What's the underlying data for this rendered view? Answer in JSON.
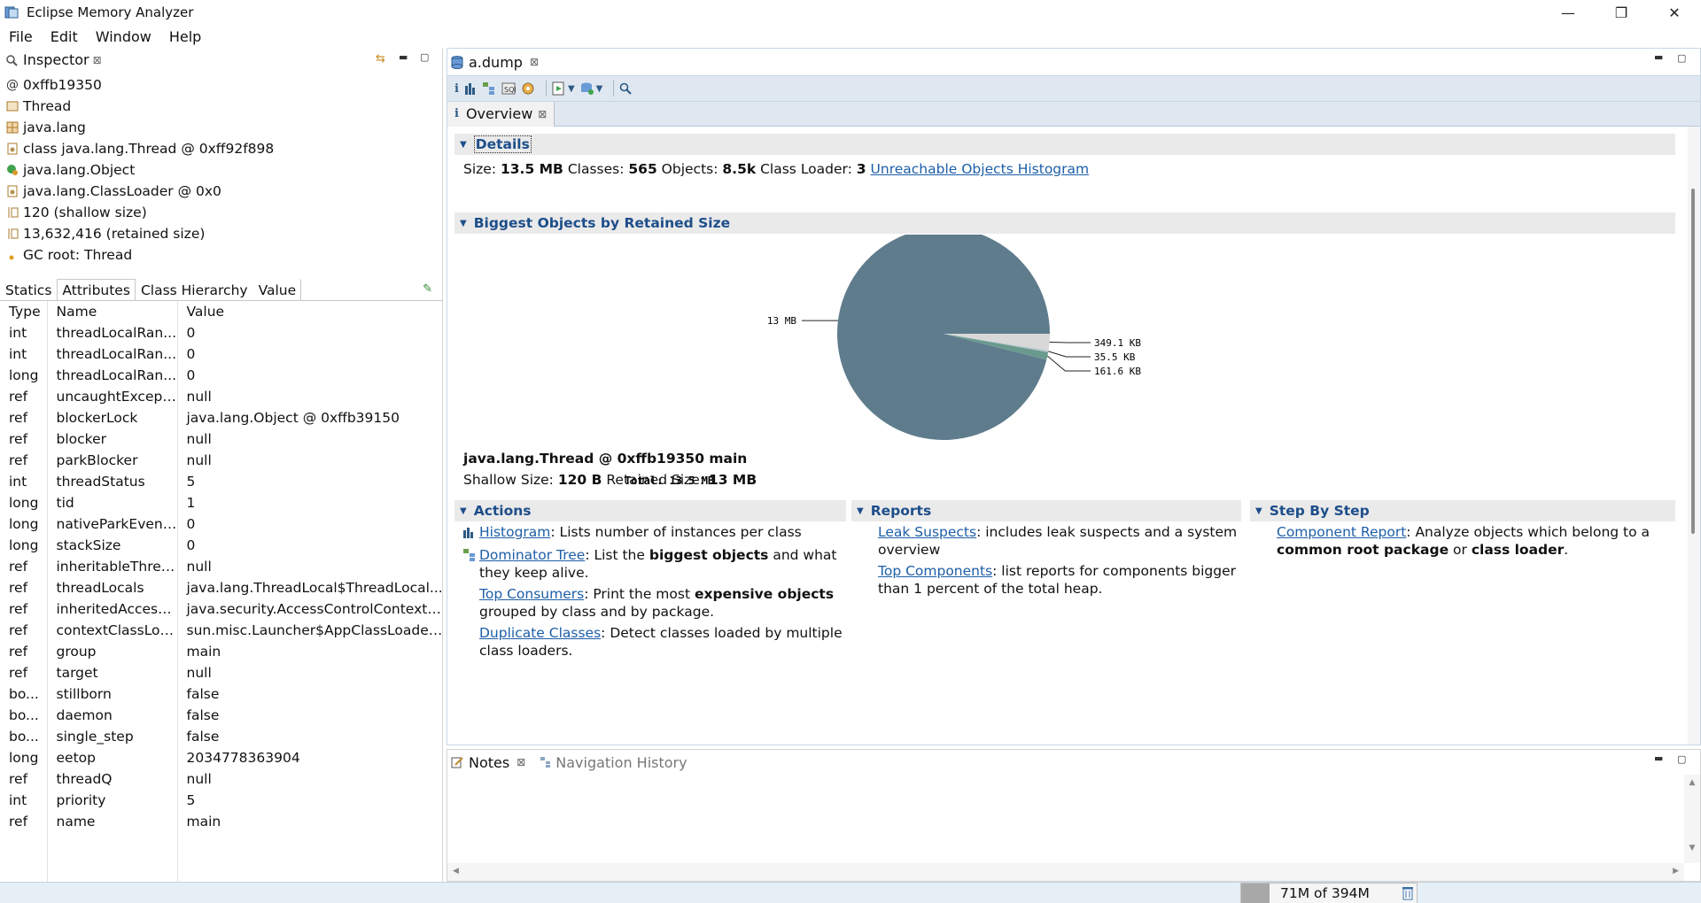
{
  "window": {
    "title": "Eclipse Memory Analyzer",
    "min": "—",
    "max": "❐",
    "close": "✕"
  },
  "menu": [
    "File",
    "Edit",
    "Window",
    "Help"
  ],
  "inspector": {
    "tab": "Inspector",
    "summary": [
      {
        "icon": "at-icon",
        "text": "0xffb19350"
      },
      {
        "icon": "class-icon",
        "text": "Thread"
      },
      {
        "icon": "package-icon",
        "text": "java.lang"
      },
      {
        "icon": "class-file-icon",
        "text": "class java.lang.Thread @ 0xff92f898"
      },
      {
        "icon": "superclass-icon",
        "text": "java.lang.Object"
      },
      {
        "icon": "classloader-icon",
        "text": "java.lang.ClassLoader @ 0x0"
      },
      {
        "icon": "size-icon",
        "text": "120 (shallow size)"
      },
      {
        "icon": "size-icon",
        "text": "13,632,416 (retained size)"
      },
      {
        "icon": "gc-root-icon",
        "text": "GC root: Thread"
      }
    ],
    "subtabs": [
      "Statics",
      "Attributes",
      "Class Hierarchy",
      "Value"
    ],
    "columns": [
      "Type",
      "Name",
      "Value"
    ],
    "rows": [
      [
        "int",
        "threadLocalRan...",
        "0"
      ],
      [
        "int",
        "threadLocalRan...",
        "0"
      ],
      [
        "long",
        "threadLocalRan...",
        "0"
      ],
      [
        "ref",
        "uncaughtExcepti...",
        "null"
      ],
      [
        "ref",
        "blockerLock",
        "java.lang.Object @ 0xffb39150"
      ],
      [
        "ref",
        "blocker",
        "null"
      ],
      [
        "ref",
        "parkBlocker",
        "null"
      ],
      [
        "int",
        "threadStatus",
        "5"
      ],
      [
        "long",
        "tid",
        "1"
      ],
      [
        "long",
        "nativeParkEvent...",
        "0"
      ],
      [
        "long",
        "stackSize",
        "0"
      ],
      [
        "ref",
        "inheritableThrea...",
        "null"
      ],
      [
        "ref",
        "threadLocals",
        "java.lang.ThreadLocal$ThreadLocal..."
      ],
      [
        "ref",
        "inheritedAccess...",
        "java.security.AccessControlContext ..."
      ],
      [
        "ref",
        "contextClassLoa...",
        "sun.misc.Launcher$AppClassLoader ..."
      ],
      [
        "ref",
        "group",
        "main"
      ],
      [
        "ref",
        "target",
        "null"
      ],
      [
        "bo...",
        "stillborn",
        "false"
      ],
      [
        "bo...",
        "daemon",
        "false"
      ],
      [
        "bo...",
        "single_step",
        "false"
      ],
      [
        "long",
        "eetop",
        "2034778363904"
      ],
      [
        "ref",
        "threadQ",
        "null"
      ],
      [
        "int",
        "priority",
        "5"
      ],
      [
        "ref",
        "name",
        "main"
      ]
    ]
  },
  "editor": {
    "tab": "a.dump",
    "overview_tab": "Overview",
    "details": {
      "header": "Details",
      "size_label": "Size:",
      "size": "13.5 MB",
      "classes_label": "Classes:",
      "classes": "565",
      "objects_label": "Objects:",
      "objects": "8.5k",
      "loader_label": "Class Loader:",
      "loader": "3",
      "unreachable_link": "Unreachable Objects Histogram"
    },
    "biggest": {
      "header": "Biggest Objects by Retained Size",
      "total": "Total: 13.5 MB",
      "object_title": "java.lang.Thread @ 0xffb19350 main",
      "shallow_label": "Shallow Size:",
      "shallow": "120 B",
      "retained_label": "Retained Size:",
      "retained": "13 MB"
    },
    "actions": {
      "header": "Actions",
      "items": [
        {
          "link": "Histogram",
          "pre": ": Lists number of instances per class",
          "bold": "",
          "post": ""
        },
        {
          "link": "Dominator Tree",
          "pre": ": List the ",
          "bold": "biggest objects",
          "post": " and what they keep alive."
        },
        {
          "link": "Top Consumers",
          "pre": ": Print the most ",
          "bold": "expensive objects",
          "post": " grouped by class and by package."
        },
        {
          "link": "Duplicate Classes",
          "pre": ": Detect classes loaded by multiple class loaders.",
          "bold": "",
          "post": ""
        }
      ]
    },
    "reports": {
      "header": "Reports",
      "items": [
        {
          "link": "Leak Suspects",
          "text": ": includes leak suspects and a system overview"
        },
        {
          "link": "Top Components",
          "text": ": list reports for components bigger than 1 percent of the total heap."
        }
      ]
    },
    "stepbystep": {
      "header": "Step By Step",
      "link": "Component Report",
      "pre": ": Analyze objects which belong to a ",
      "bold1": "common root package",
      "mid": " or ",
      "bold2": "class loader",
      "post": "."
    }
  },
  "chart_data": {
    "type": "pie",
    "title": "",
    "total": "Total: 13.5 MB",
    "labels": [
      "13 MB",
      "349.1 KB",
      "35.5 KB",
      "161.6 KB"
    ],
    "values": [
      13312,
      349.1,
      35.5,
      161.6
    ],
    "colors": [
      "#5f7c8d",
      "#d8d8d8",
      "#b8c8cf",
      "#6a9a8e"
    ]
  },
  "notes": {
    "tab": "Notes",
    "nav_tab": "Navigation History"
  },
  "status": {
    "heap": "71M of 394M"
  }
}
